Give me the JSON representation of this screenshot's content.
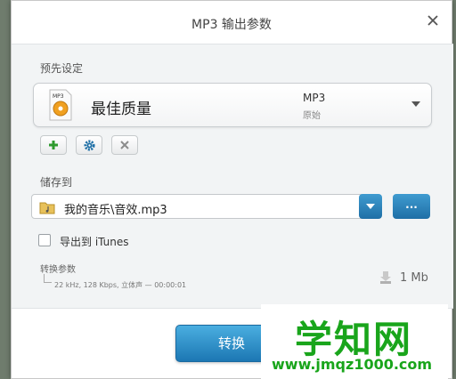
{
  "dialog": {
    "title": "MP3 输出参数",
    "close_icon": "close-icon"
  },
  "preset": {
    "section_label": "预先设定",
    "name": "最佳质量",
    "format": "MP3",
    "format_sub": "原始",
    "icon_label": "MP3",
    "icon": "mp3-file-icon"
  },
  "preset_buttons": [
    {
      "icon": "plus-icon",
      "color": "#2e9a2e"
    },
    {
      "icon": "gear-icon",
      "color": "#1f6fa6"
    },
    {
      "icon": "x-icon",
      "color": "#8c8c8c"
    }
  ],
  "save": {
    "section_label": "储存到",
    "path": "我的音乐\\音效.mp3",
    "browse_label": "..."
  },
  "export": {
    "label": "导出到 iTunes",
    "checked": false
  },
  "conversion": {
    "label": "转换参数",
    "detail": "22 kHz, 128 Kbps, 立体声 — 00:00:01",
    "size": "1 Mb"
  },
  "convert_button": "转换",
  "watermark": {
    "title": "学知网",
    "url": "www.jmqz1000.com"
  },
  "colors": {
    "accent": "#1f6fa6",
    "watermark": "#19a51b"
  }
}
